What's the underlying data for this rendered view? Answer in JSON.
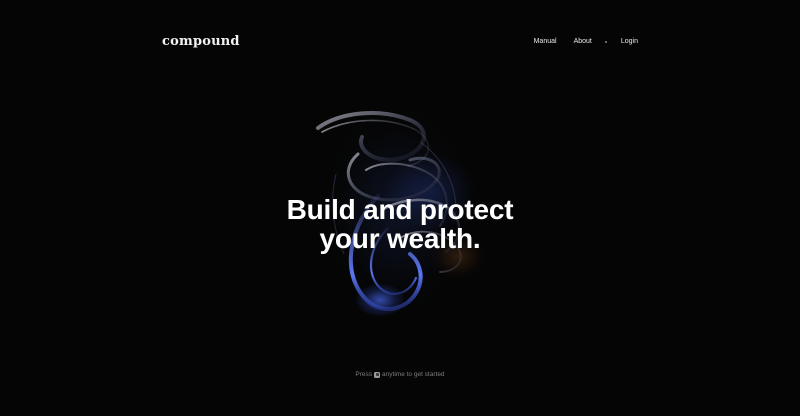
{
  "header": {
    "logo": "compound",
    "nav": {
      "manual": "Manual",
      "about": "About",
      "login": "Login"
    }
  },
  "hero": {
    "headline_line1": "Build and protect",
    "headline_line2": "your wealth."
  },
  "footer_hint": {
    "before": "Press",
    "key_icon": "keyboard-key-icon",
    "after": "anytime to get started"
  },
  "colors": {
    "background": "#050505",
    "text": "#ffffff",
    "accent_blue": "#4c6cff",
    "accent_amber": "#7a4a1e"
  }
}
